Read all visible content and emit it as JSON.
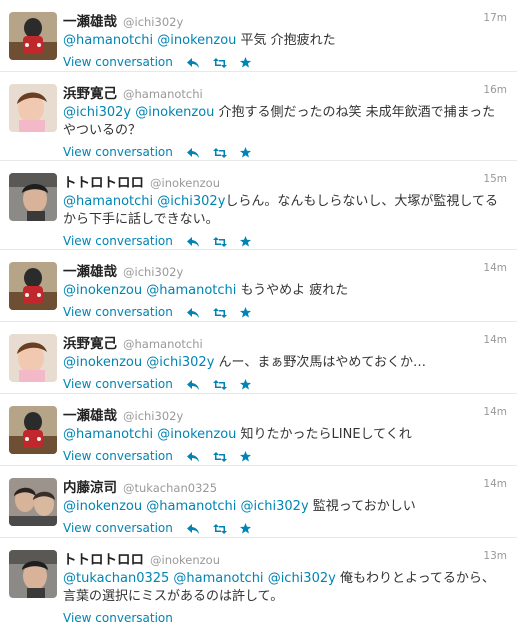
{
  "tweets": [
    {
      "fullname": "一瀬雄哉",
      "username": "@ichi302y",
      "time": "17m",
      "mentions": [
        "@hamanotchi",
        "@inokenzou"
      ],
      "text": "平気 介抱疲れた",
      "view_label": "View conversation",
      "avatar": "avatar-ichinose"
    },
    {
      "fullname": "浜野寛己",
      "username": "@hamanotchi",
      "time": "16m",
      "mentions": [
        "@ichi302y",
        "@inokenzou"
      ],
      "text": "介抱する側だったのね笑 未成年飲酒で捕まったやついるの？",
      "view_label": "View conversation",
      "avatar": "avatar-hamano"
    },
    {
      "fullname": "トトロトロロ",
      "username": "@inokenzou",
      "time": "15m",
      "mentions": [
        "@hamanotchi",
        "@ichi302y"
      ],
      "text": "しらん。なんもしらないし、大塚が監視してるから下手に話しできない。",
      "view_label": "View conversation",
      "avatar": "avatar-totoro"
    },
    {
      "fullname": "一瀬雄哉",
      "username": "@ichi302y",
      "time": "14m",
      "mentions": [
        "@inokenzou",
        "@hamanotchi"
      ],
      "text": "もうやめよ 疲れた",
      "view_label": "View conversation",
      "avatar": "avatar-ichinose"
    },
    {
      "fullname": "浜野寛己",
      "username": "@hamanotchi",
      "time": "14m",
      "mentions": [
        "@inokenzou",
        "@ichi302y"
      ],
      "text": "んー、まぁ野次馬はやめておくか…",
      "view_label": "View conversation",
      "avatar": "avatar-hamano"
    },
    {
      "fullname": "一瀬雄哉",
      "username": "@ichi302y",
      "time": "14m",
      "mentions": [
        "@hamanotchi",
        "@inokenzou"
      ],
      "text": "知りたかったらLINEしてくれ",
      "view_label": "View conversation",
      "avatar": "avatar-ichinose"
    },
    {
      "fullname": "内藤涼司",
      "username": "@tukachan0325",
      "time": "14m",
      "mentions": [
        "@inokenzou",
        "@hamanotchi",
        "@ichi302y"
      ],
      "text": "監視っておかしい",
      "view_label": "View conversation",
      "avatar": "avatar-naito"
    },
    {
      "fullname": "トトロトロロ",
      "username": "@inokenzou",
      "time": "13m",
      "mentions": [
        "@tukachan0325",
        "@hamanotchi",
        "@ichi302y"
      ],
      "text": "俺もわりとよってるから、言葉の選択にミスがあるのは許して。",
      "view_label": "View conversation",
      "avatar": "avatar-totoro"
    }
  ],
  "icons": {
    "reply": "reply-icon",
    "retweet": "retweet-icon",
    "favorite": "favorite-icon"
  },
  "colors": {
    "link": "#0084b4",
    "meta": "#999999",
    "text": "#333333"
  }
}
